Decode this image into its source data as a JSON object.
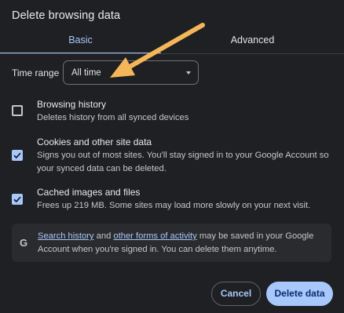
{
  "dialog": {
    "title": "Delete browsing data"
  },
  "tabs": [
    {
      "label": "Basic",
      "active": true
    },
    {
      "label": "Advanced",
      "active": false
    }
  ],
  "time_range": {
    "label": "Time range",
    "value": "All time"
  },
  "options": [
    {
      "title": "Browsing history",
      "description": "Deletes history from all synced devices",
      "checked": false
    },
    {
      "title": "Cookies and other site data",
      "description": "Signs you out of most sites. You'll stay signed in to your Google Account so your synced data can be deleted.",
      "checked": true
    },
    {
      "title": "Cached images and files",
      "description": "Frees up 219 MB. Some sites may load more slowly on your next visit.",
      "checked": true
    }
  ],
  "info": {
    "icon": "G",
    "link_search_history": "Search history",
    "text_and": " and ",
    "link_other_activity": "other forms of activity",
    "text_rest": " may be saved in your Google Account when you're signed in. You can delete them anytime."
  },
  "buttons": {
    "cancel": "Cancel",
    "delete": "Delete data"
  },
  "colors": {
    "accent": "#a8c7fa",
    "background": "#1f2023",
    "annotation_arrow": "#f5b65a"
  }
}
